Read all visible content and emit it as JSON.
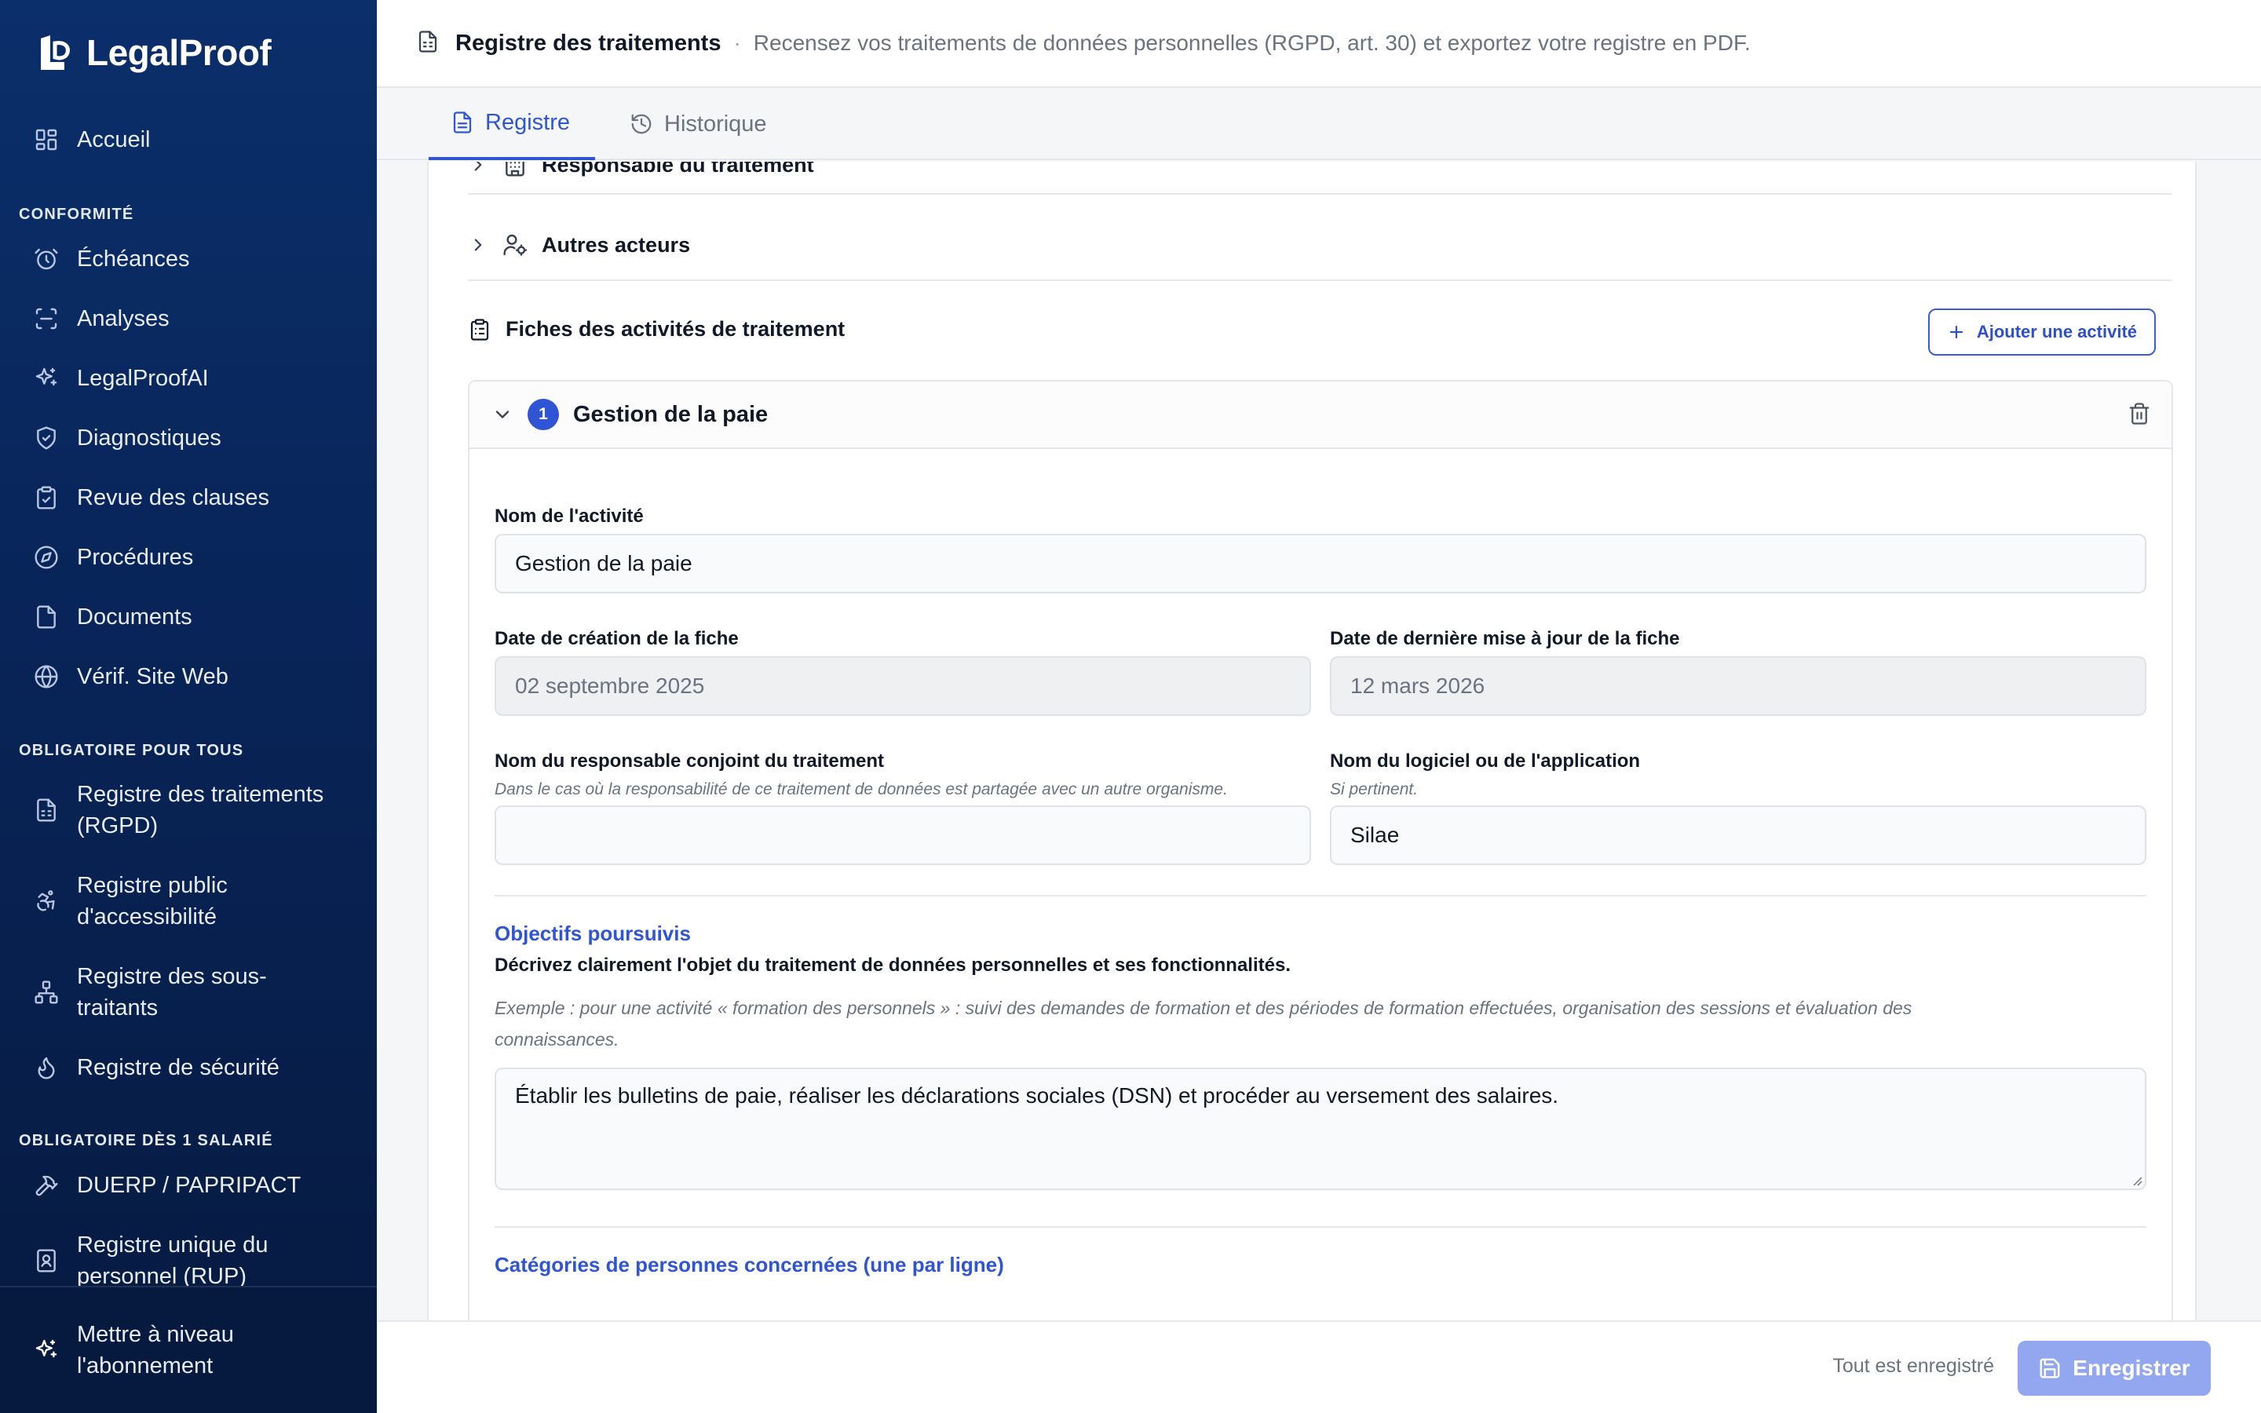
{
  "app": {
    "name": "LegalProof"
  },
  "sidebar": {
    "home": {
      "label": "Accueil",
      "icon": "dashboard-icon"
    },
    "sections": [
      {
        "title": "CONFORMITÉ"
      },
      {
        "title": "OBLIGATOIRE POUR TOUS"
      },
      {
        "title": "OBLIGATOIRE DÈS 1 SALARIÉ"
      }
    ],
    "items": [
      {
        "label": "Échéances",
        "icon": "alarm-clock-icon"
      },
      {
        "label": "Analyses",
        "icon": "scan-icon"
      },
      {
        "label": "LegalProofAI",
        "icon": "sparkles-icon"
      },
      {
        "label": "Diagnostiques",
        "icon": "shield-check-icon"
      },
      {
        "label": "Revue des clauses",
        "icon": "clipboard-check-icon"
      },
      {
        "label": "Procédures",
        "icon": "compass-icon"
      },
      {
        "label": "Documents",
        "icon": "file-icon"
      },
      {
        "label": "Vérif. Site Web",
        "icon": "globe-icon"
      },
      {
        "label_1": "Registre des traitements",
        "label_2": "(RGPD)",
        "icon": "file-text-icon"
      },
      {
        "label_1": "Registre public",
        "label_2": "d'accessibilité",
        "icon": "accessibility-icon"
      },
      {
        "label_1": "Registre des sous-",
        "label_2": "traitants",
        "icon": "network-icon"
      },
      {
        "label": "Registre de sécurité",
        "icon": "flame-icon"
      },
      {
        "label": "DUERP / PAPRIPACT",
        "icon": "hammer-icon"
      },
      {
        "label_1": "Registre unique du",
        "label_2": "personnel (RUP)",
        "icon": "id-badge-icon"
      }
    ],
    "upgrade": {
      "label_1": "Mettre à niveau",
      "label_2": "l'abonnement",
      "icon": "sparkles-icon"
    }
  },
  "header": {
    "title": "Registre des traitements",
    "separator": "·",
    "subtitle": "Recensez vos traitements de données personnelles (RGPD, art. 30) et exportez votre registre en PDF."
  },
  "tabs": [
    {
      "label": "Registre",
      "active": true
    },
    {
      "label": "Historique",
      "active": false
    }
  ],
  "register": {
    "collapsed_sections": [
      "Responsable du traitement",
      "Autres acteurs"
    ],
    "activities_title": "Fiches des activités de traitement",
    "add_activity_label": "Ajouter une activité",
    "activity": {
      "number": "1",
      "name": "Gestion de la paie",
      "fields": {
        "name_label": "Nom de l'activité",
        "name_value": "Gestion de la paie",
        "created_label": "Date de création de la fiche",
        "created_value": "02 septembre 2025",
        "updated_label": "Date de dernière mise à jour de la fiche",
        "updated_value": "12 mars 2026",
        "joint_label": "Nom du responsable conjoint du traitement",
        "joint_hint": "Dans le cas où la responsabilité de ce traitement de données est partagée avec un autre organisme.",
        "joint_value": "",
        "software_label": "Nom du logiciel ou de l'application",
        "software_hint": "Si pertinent.",
        "software_value": "Silae"
      },
      "objectives": {
        "title": "Objectifs poursuivis",
        "description": "Décrivez clairement l'objet du traitement de données personnelles et ses fonctionnalités.",
        "example_line_1": "Exemple : pour une activité « formation des personnels » : suivi des demandes de formation et des périodes de formation effectuées, organisation des sessions et évaluation des",
        "example_line_2": "connaissances.",
        "value": "Établir les bulletins de paie, réaliser les déclarations sociales (DSN) et procéder au versement des salaires."
      },
      "categories": {
        "title": "Catégories de personnes concernées (une par ligne)"
      }
    }
  },
  "footer": {
    "status": "Tout est enregistré",
    "save_label": "Enregistrer"
  },
  "colors": {
    "sidebar_top": "#0b2f6b",
    "sidebar_bottom": "#061a3f",
    "accent": "#2f55d4",
    "save_button": "#93a6f0"
  }
}
